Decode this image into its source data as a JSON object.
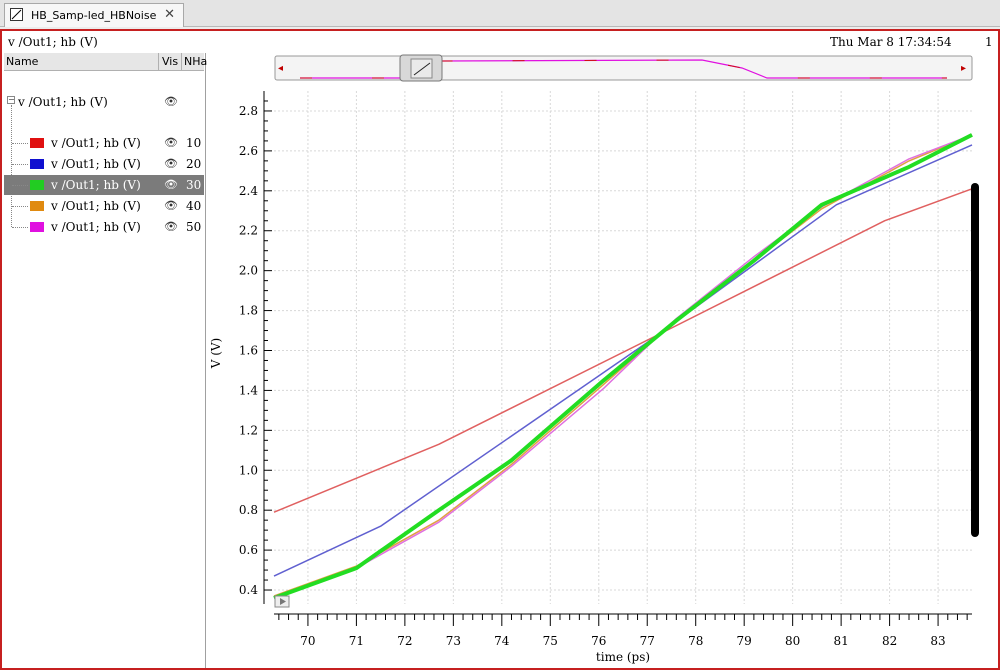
{
  "tab": {
    "title": "HB_Samp-led_HBNoise",
    "close": "✕"
  },
  "header": {
    "trace": "v /Out1; hb (V)",
    "date": "Thu Mar 8 17:34:54",
    "page": "1"
  },
  "panel": {
    "col_name": "Name",
    "col_vis": "Vis",
    "col_nh": "NHa",
    "root_label": "v /Out1; hb (V)",
    "rows": [
      {
        "label": "v /Out1; hb (V)",
        "nh": "10",
        "color": "#e01010",
        "selected": false
      },
      {
        "label": "v /Out1; hb (V)",
        "nh": "20",
        "color": "#1010d0",
        "selected": false
      },
      {
        "label": "v /Out1; hb (V)",
        "nh": "30",
        "color": "#22cc22",
        "selected": true
      },
      {
        "label": "v /Out1; hb (V)",
        "nh": "40",
        "color": "#e08a10",
        "selected": false
      },
      {
        "label": "v /Out1; hb (V)",
        "nh": "50",
        "color": "#e010e0",
        "selected": false
      }
    ]
  },
  "chart_data": {
    "type": "line",
    "xlabel": "time (ps)",
    "ylabel": "V (V)",
    "xlim": [
      69.3,
      83.7
    ],
    "ylim": [
      0.33,
      2.9
    ],
    "xticks": [
      70,
      71,
      72,
      73,
      74,
      75,
      76,
      77,
      78,
      79,
      80,
      81,
      82,
      83
    ],
    "yticks": [
      0.4,
      0.6,
      0.8,
      1.0,
      1.2,
      1.4,
      1.6,
      1.8,
      2.0,
      2.2,
      2.4,
      2.6,
      2.8
    ],
    "grid": true,
    "series": [
      {
        "name": "10",
        "color": "#e06060",
        "width": 1.5,
        "x": [
          69.3,
          72.7,
          77.4,
          81.9,
          83.7
        ],
        "y": [
          0.79,
          1.13,
          1.7,
          2.25,
          2.41
        ]
      },
      {
        "name": "20",
        "color": "#6060d0",
        "width": 1.5,
        "x": [
          69.3,
          71.5,
          77.0,
          80.9,
          83.7
        ],
        "y": [
          0.47,
          0.72,
          1.64,
          2.33,
          2.63
        ]
      },
      {
        "name": "40",
        "color": "#e0a040",
        "width": 1.5,
        "x": [
          69.3,
          71.0,
          72.7,
          74.2,
          76.1,
          77.6,
          79.2,
          80.6,
          82.4,
          83.7
        ],
        "y": [
          0.37,
          0.52,
          0.75,
          1.03,
          1.43,
          1.75,
          2.05,
          2.31,
          2.55,
          2.68
        ]
      },
      {
        "name": "50",
        "color": "#e070e0",
        "width": 1.5,
        "x": [
          69.3,
          71.0,
          72.7,
          74.2,
          76.1,
          77.6,
          79.2,
          80.6,
          82.4,
          83.7
        ],
        "y": [
          0.36,
          0.51,
          0.74,
          1.02,
          1.41,
          1.76,
          2.07,
          2.32,
          2.56,
          2.68
        ]
      },
      {
        "name": "30",
        "color": "#22dd22",
        "width": 4,
        "x": [
          69.3,
          71.0,
          72.7,
          74.2,
          76.1,
          77.6,
          79.2,
          80.6,
          82.4,
          83.7
        ],
        "y": [
          0.36,
          0.51,
          0.8,
          1.05,
          1.45,
          1.75,
          2.05,
          2.33,
          2.52,
          2.68
        ]
      }
    ]
  },
  "overview": {
    "left_arrow": "◂",
    "right_arrow": "▸"
  }
}
